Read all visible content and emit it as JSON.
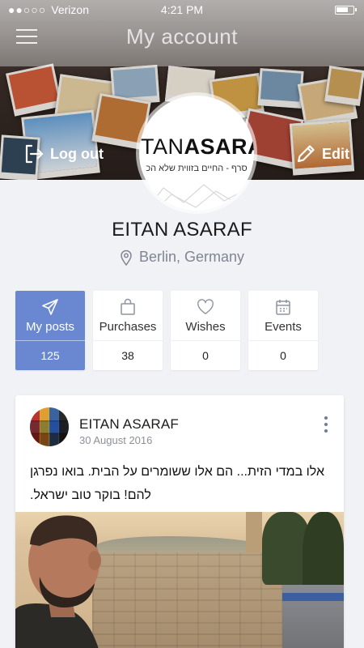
{
  "status_bar": {
    "signal_dots": "●●○○○",
    "carrier": "Verizon",
    "time": "4:21 PM"
  },
  "header": {
    "title": "My account",
    "menu_icon": "hamburger-menu-icon",
    "logout_label": "Log out",
    "logout_icon": "logout-arrow-icon",
    "edit_label": "Edit",
    "edit_icon": "pencil-icon"
  },
  "avatar": {
    "logo_light": "ITAN",
    "logo_bold": "ASARA",
    "subtitle": "סרף - החיים בזווית שלא הכ"
  },
  "profile": {
    "name": "EITAN ASARAF",
    "location": "Berlin, Germany",
    "location_icon": "location-pin-icon"
  },
  "tabs": [
    {
      "label": "My posts",
      "count": "125",
      "icon": "paper-plane-icon",
      "active": true
    },
    {
      "label": "Purchases",
      "count": "38",
      "icon": "shopping-bag-icon",
      "active": false
    },
    {
      "label": "Wishes",
      "count": "0",
      "icon": "heart-icon",
      "active": false
    },
    {
      "label": "Events",
      "count": "0",
      "icon": "calendar-icon",
      "active": false
    }
  ],
  "post": {
    "author": "EITAN ASARAF",
    "date": "30 August 2016",
    "text": "אלו במדי הזית... הם אלו ששומרים על הבית. בואו נפרגן להם! בוקר טוב ישראל.",
    "more_icon": "vertical-dots-icon"
  },
  "colors": {
    "accent": "#6a88d2",
    "background": "#f1f2f6",
    "muted_text": "#7f8592"
  }
}
